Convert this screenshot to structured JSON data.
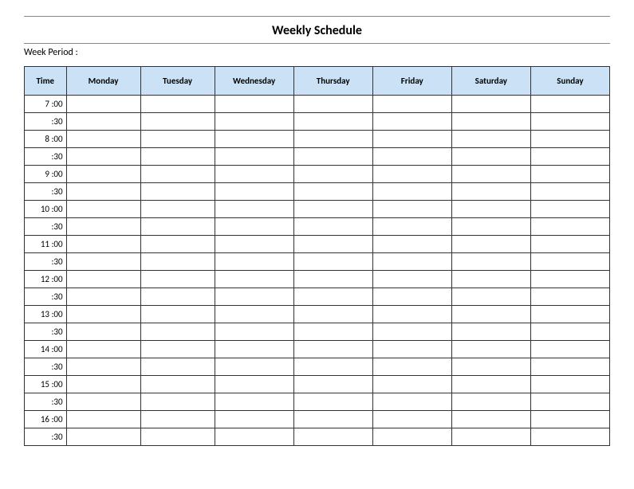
{
  "title": "Weekly Schedule",
  "week_period_label": "Week Period :",
  "headers": {
    "time": "Time",
    "days": [
      "Monday",
      "Tuesday",
      "Wednesday",
      "Thursday",
      "Friday",
      "Saturday",
      "Sunday"
    ]
  },
  "time_rows": [
    "7  :00",
    ":30",
    "8  :00",
    ":30",
    "9  :00",
    ":30",
    "10  :00",
    ":30",
    "11  :00",
    ":30",
    "12  :00",
    ":30",
    "13  :00",
    ":30",
    "14  :00",
    ":30",
    "15  :00",
    ":30",
    "16  :00",
    ":30"
  ]
}
